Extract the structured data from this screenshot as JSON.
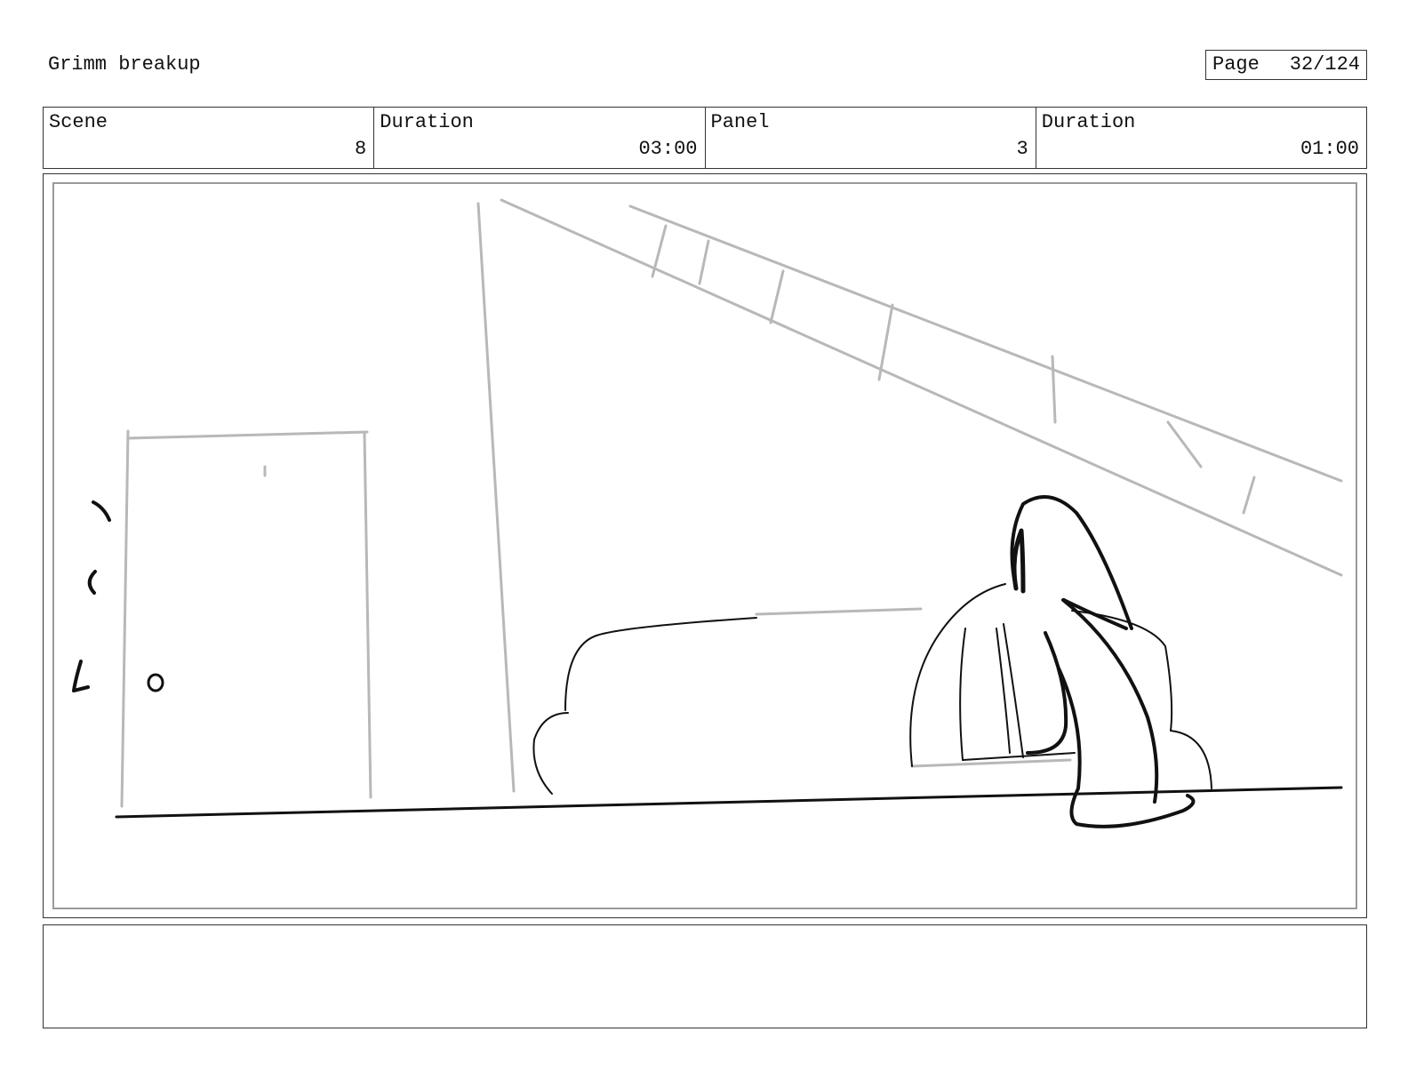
{
  "header": {
    "project_title": "Grimm breakup",
    "page_label": "Page",
    "page_number": "32/124"
  },
  "info": {
    "scene_label": "Scene",
    "scene_value": "8",
    "scene_duration_label": "Duration",
    "scene_duration_value": "03:00",
    "panel_label": "Panel",
    "panel_value": "3",
    "panel_duration_label": "Duration",
    "panel_duration_value": "01:00"
  },
  "frame": {
    "sketch_color": "#b8b8b8",
    "ink_color": "#111111"
  },
  "notes": {
    "text": ""
  }
}
